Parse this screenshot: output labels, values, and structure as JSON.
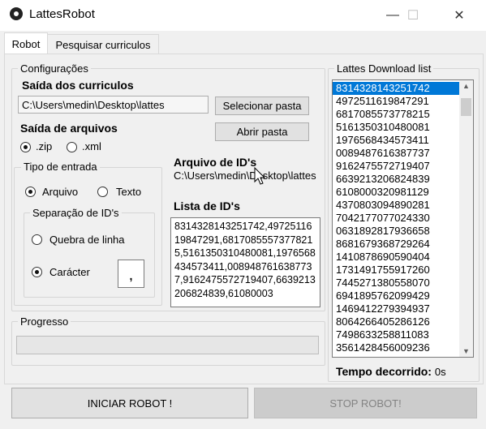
{
  "window": {
    "title": "LattesRobot",
    "minimize_glyph": "—",
    "maximize_glyph": "☐",
    "close_glyph": "✕"
  },
  "tabs": [
    {
      "label": "Robot"
    },
    {
      "label": "Pesquisar curriculos"
    }
  ],
  "config": {
    "legend": "Configurações",
    "saida_curriculos_label": "Saída dos curriculos",
    "saida_curriculos_path": "C:\\Users\\medin\\Desktop\\lattes",
    "selecionar_pasta_label": "Selecionar pasta",
    "abrir_pasta_label": "Abrir pasta",
    "saida_arquivos_label": "Saída de arquivos",
    "zip_label": ".zip",
    "xml_label": ".xml",
    "tipo_entrada_legend": "Tipo de entrada",
    "arquivo_label": "Arquivo",
    "texto_label": "Texto",
    "separacao_legend": "Separação de ID's",
    "quebra_linha_label": "Quebra de linha",
    "caracter_label": "Carácter",
    "caracter_value": ",",
    "arquivo_ids_label": "Arquivo de ID's",
    "arquivo_ids_path": "C:\\Users\\medin\\Desktop\\lattes",
    "lista_ids_label": "Lista de ID's",
    "lista_ids_text": "8314328143251742,4972511619847291,6817085557377821 5,5161350310480081,1976568434573411,0089487616387737,9162475572719407,6639213206824839,61080003"
  },
  "downloads": {
    "legend": "Lattes Download list",
    "items": [
      "8314328143251742",
      "4972511619847291",
      "6817085573778215",
      "5161350310480081",
      "1976568434573411",
      "0089487616387737",
      "9162475572719407",
      "6639213206824839",
      "6108000320981129",
      "4370803094890281",
      "7042177077024330",
      "0631892817936658",
      "8681679368729264",
      "1410878690590404",
      "1731491755917260",
      "7445271380558070",
      "6941895762099429",
      "1469412279394937",
      "8064266405286126",
      "7498633258811083",
      "3561428456009236"
    ],
    "elapsed_label": "Tempo decorrido:",
    "elapsed_value": "0s"
  },
  "progress": {
    "legend": "Progresso",
    "value": 0
  },
  "actions": {
    "start_label": "INICIAR ROBOT !",
    "stop_label": "STOP ROBOT!"
  }
}
